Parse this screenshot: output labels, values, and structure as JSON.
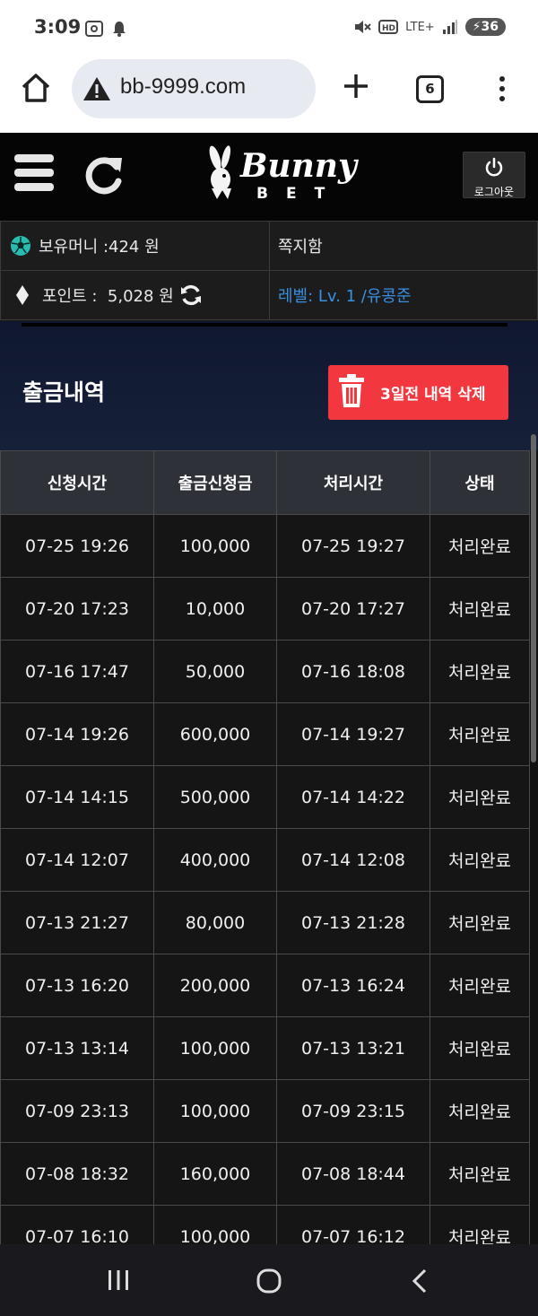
{
  "status_bar": {
    "time": "3:09",
    "lte": "LTE+",
    "battery": "36",
    "icons": [
      "screenshot-icon",
      "notification-bell-icon",
      "mute-icon",
      "hd-icon",
      "lte-icon",
      "signal-icon",
      "battery-icon"
    ]
  },
  "browser": {
    "url": "bb-9999.com",
    "tab_count": "6"
  },
  "site_header": {
    "logo_text": "Bunny",
    "logo_subtext": "BET",
    "logout_label": "로그아웃"
  },
  "info": {
    "money": "보유머니 :424 원",
    "messages": "쪽지함",
    "points": "포인트 :  5,028 원",
    "level": "레벨: Lv. 1 /유콩준"
  },
  "withdrawal": {
    "title": "출금내역",
    "delete_button": "3일전 내역 삭제"
  },
  "table": {
    "headers": [
      "신청시간",
      "출금신청금",
      "처리시간",
      "상태"
    ],
    "rows": [
      [
        "07-25 19:26",
        "100,000",
        "07-25 19:27",
        "처리완료"
      ],
      [
        "07-20 17:23",
        "10,000",
        "07-20 17:27",
        "처리완료"
      ],
      [
        "07-16 17:47",
        "50,000",
        "07-16 18:08",
        "처리완료"
      ],
      [
        "07-14 19:26",
        "600,000",
        "07-14 19:27",
        "처리완료"
      ],
      [
        "07-14 14:15",
        "500,000",
        "07-14 14:22",
        "처리완료"
      ],
      [
        "07-14 12:07",
        "400,000",
        "07-14 12:08",
        "처리완료"
      ],
      [
        "07-13 21:27",
        "80,000",
        "07-13 21:28",
        "처리완료"
      ],
      [
        "07-13 16:20",
        "200,000",
        "07-13 16:24",
        "처리완료"
      ],
      [
        "07-13 13:14",
        "100,000",
        "07-13 13:21",
        "처리완료"
      ],
      [
        "07-09 23:13",
        "100,000",
        "07-09 23:15",
        "처리완료"
      ],
      [
        "07-08 18:32",
        "160,000",
        "07-08 18:44",
        "처리완료"
      ],
      [
        "07-07 16:10",
        "100,000",
        "07-07 16:12",
        "처리완료"
      ]
    ]
  },
  "colors": {
    "accent_red": "#f2373f",
    "level_blue": "#3a8fe0",
    "header_bg": "#2e3238"
  }
}
